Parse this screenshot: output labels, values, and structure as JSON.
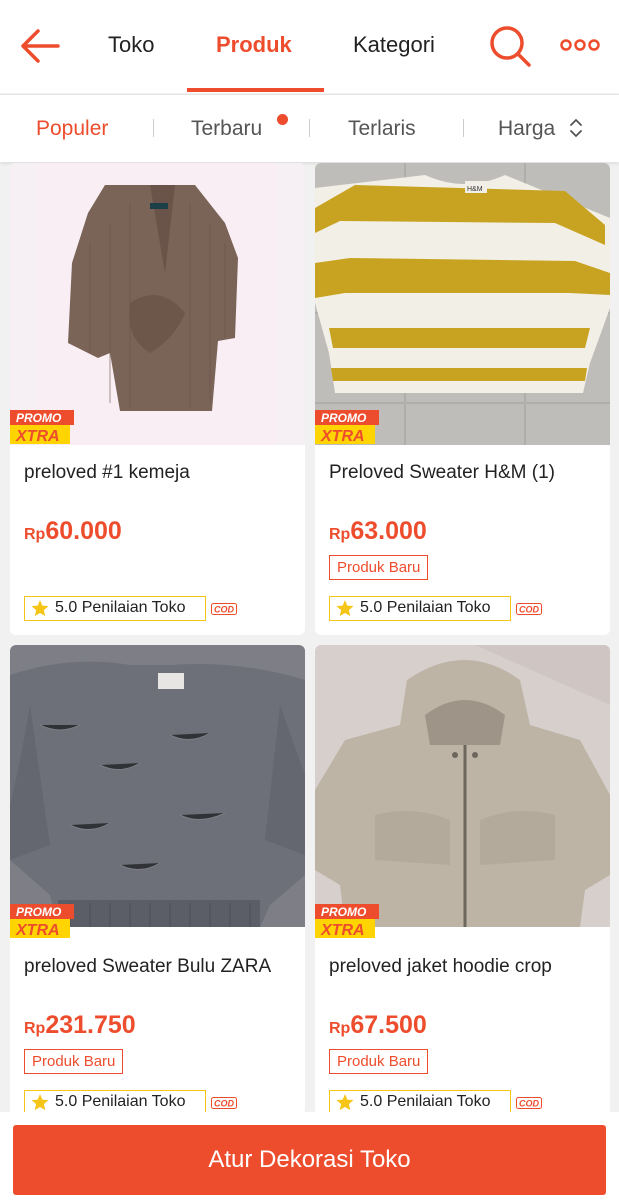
{
  "header": {
    "tabs": [
      "Toko",
      "Produk",
      "Kategori"
    ],
    "active_tab": "Produk"
  },
  "sort": {
    "options": [
      "Populer",
      "Terbaru",
      "Terlaris",
      "Harga"
    ],
    "active": "Populer"
  },
  "products": [
    {
      "name": "preloved #1 kemeja",
      "currency": "Rp",
      "price": "60.000",
      "promo": [
        "PROMO",
        "XTRA"
      ],
      "rating": "5.0 Penilaian Toko",
      "cod": "COD",
      "image": "brown-cardigan"
    },
    {
      "name": "Preloved Sweater H&M (1)",
      "currency": "Rp",
      "price": "63.000",
      "badge": "Produk Baru",
      "promo": [
        "PROMO",
        "XTRA"
      ],
      "rating": "5.0 Penilaian Toko",
      "cod": "COD",
      "image": "striped-sweater"
    },
    {
      "name": "preloved Sweater Bulu ZARA",
      "currency": "Rp",
      "price": "231.750",
      "badge": "Produk Baru",
      "promo": [
        "PROMO",
        "XTRA"
      ],
      "rating": "5.0 Penilaian Toko",
      "cod": "COD",
      "image": "grey-fluffy-sweater"
    },
    {
      "name": "preloved jaket hoodie crop",
      "currency": "Rp",
      "price": "67.500",
      "badge": "Produk Baru",
      "promo": [
        "PROMO",
        "XTRA"
      ],
      "rating": "5.0 Penilaian Toko",
      "cod": "COD",
      "image": "beige-hoodie"
    }
  ],
  "cta": {
    "label": "Atur Dekorasi Toko"
  },
  "colors": {
    "accent": "#ee4d2d",
    "star": "#f5c518",
    "promo_yellow": "#ffd400"
  },
  "icons": [
    "back-arrow-icon",
    "search-icon",
    "more-icon",
    "chevron-updown-icon",
    "star-icon"
  ]
}
